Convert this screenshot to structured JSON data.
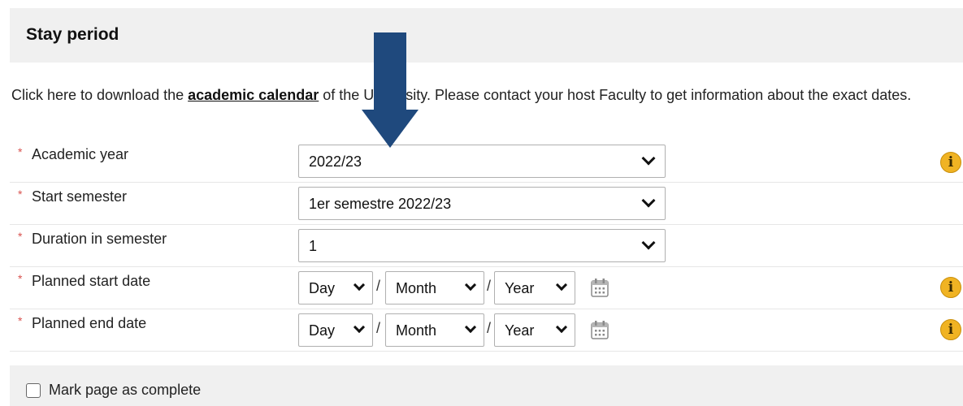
{
  "section": {
    "title": "Stay period"
  },
  "intro": {
    "text_before": "Click here to download the ",
    "link_text": "academic calendar",
    "text_after": " of the University. Please contact your host Faculty to get information about the exact dates."
  },
  "fields": {
    "academic_year": {
      "required_mark": "*",
      "label": "Academic year",
      "value": "2022/23"
    },
    "start_semester": {
      "required_mark": "*",
      "label": "Start semester",
      "value": "1er semestre 2022/23"
    },
    "duration": {
      "required_mark": "*",
      "label": "Duration in semester",
      "value": "1"
    },
    "planned_start": {
      "required_mark": "*",
      "label": "Planned start date",
      "day": "Day",
      "month": "Month",
      "year": "Year",
      "sep": "/"
    },
    "planned_end": {
      "required_mark": "*",
      "label": "Planned end date",
      "day": "Day",
      "month": "Month",
      "year": "Year",
      "sep": "/"
    }
  },
  "info_glyph": "i",
  "footer": {
    "checkbox_label": "Mark page as complete"
  },
  "colors": {
    "arrow": "#1f497d",
    "required": "#d9534f",
    "info": "#f0b323",
    "header_bg": "#f0f0f0"
  },
  "icons": {
    "calendar": "calendar-icon",
    "info": "info-icon",
    "dropdown": "chevron-down-icon"
  }
}
